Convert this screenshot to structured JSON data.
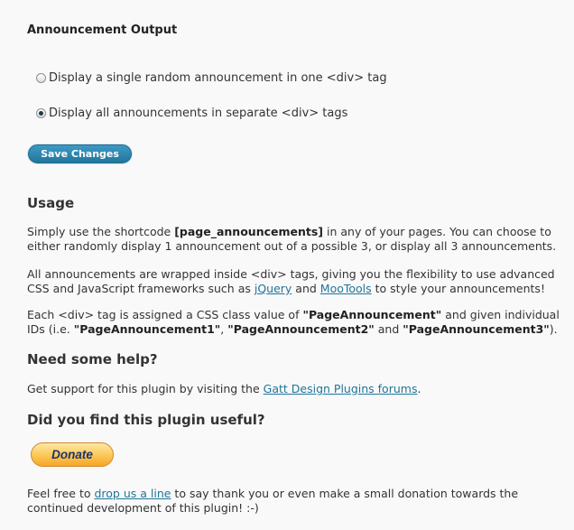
{
  "output": {
    "title": "Announcement Output",
    "option_single": "Display a single random announcement in one <div> tag",
    "option_all": "Display all announcements in separate <div> tags",
    "selected": "all",
    "save_label": "Save Changes"
  },
  "usage": {
    "heading": "Usage",
    "p1_a": "Simply use the shortcode ",
    "p1_code": "[page_announcements]",
    "p1_b": " in any of your pages. You can choose to either randomly display 1 announcement out of a possible 3, or display all 3 announcements.",
    "p2_a": "All announcements are wrapped inside <div> tags, giving you the flexibility to use advanced CSS and JavaScript frameworks such as ",
    "link_jquery": "jQuery",
    "p2_and": " and ",
    "link_mootools": "MooTools",
    "p2_b": " to style your announcements!",
    "p3_a": "Each <div> tag is assigned a CSS class value of ",
    "p3_class": "\"PageAnnouncement\"",
    "p3_b": " and given individual IDs (i.e. ",
    "p3_id1": "\"PageAnnouncement1\"",
    "p3_comma": ", ",
    "p3_id2": "\"PageAnnouncement2\"",
    "p3_and": " and ",
    "p3_id3": "\"PageAnnouncement3\"",
    "p3_end": ")."
  },
  "help": {
    "heading": "Need some help?",
    "text_a": "Get support for this plugin by visiting the ",
    "link": "Gatt Design Plugins forums",
    "text_b": "."
  },
  "useful": {
    "heading": "Did you find this plugin useful?",
    "donate_label": "Donate",
    "text_a": "Feel free to ",
    "link": "drop us a line",
    "text_b": " to say thank you or even make a small donation towards the continued development of this plugin! :-)"
  }
}
